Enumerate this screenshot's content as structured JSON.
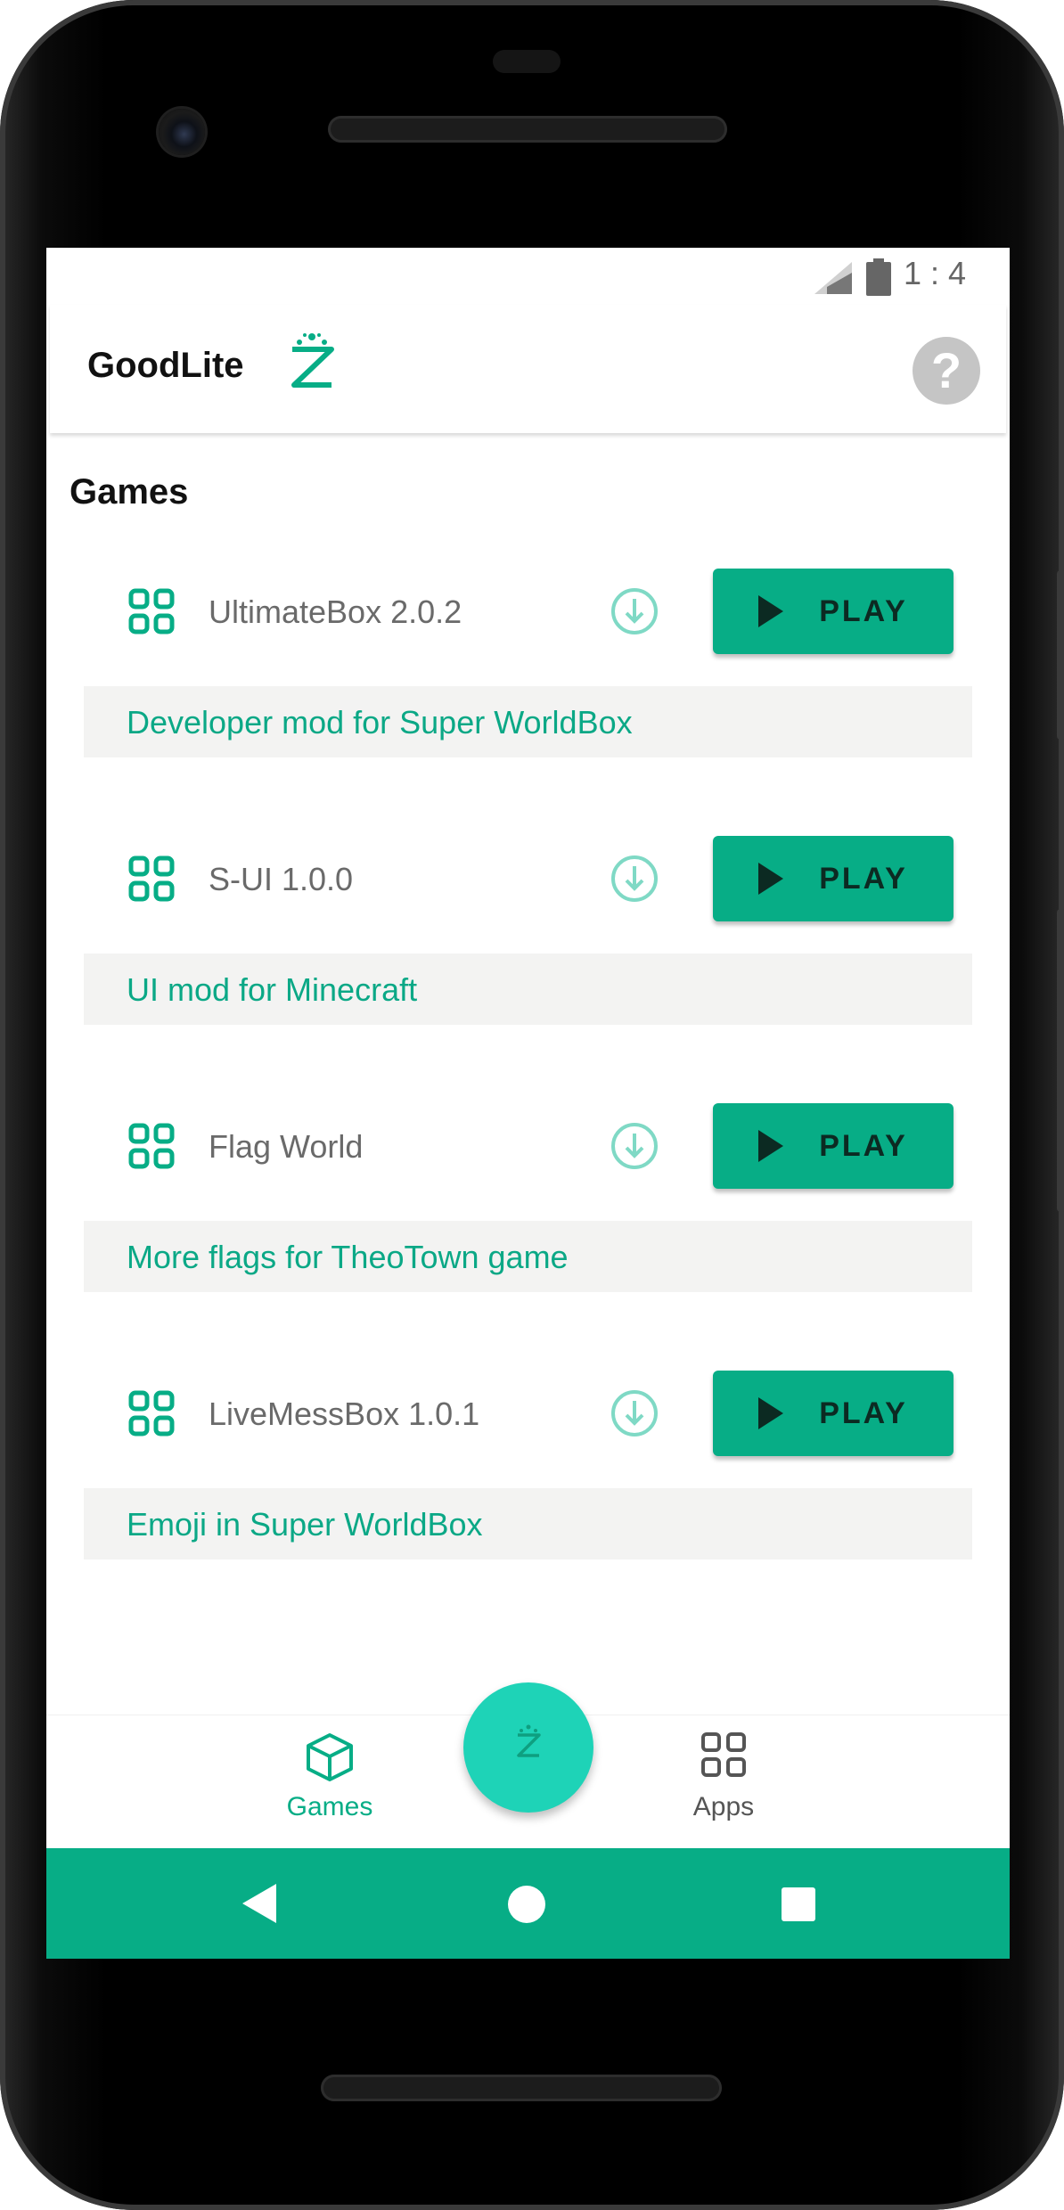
{
  "status_bar": {
    "time": "1:4"
  },
  "app_bar": {
    "logo_text": "GoodLite",
    "help_symbol": "?"
  },
  "section": {
    "title": "Games"
  },
  "items": [
    {
      "name": "UltimateBox 2.0.2",
      "play_label": "PLAY",
      "description": "Developer mod for Super WorldBox"
    },
    {
      "name": "S-UI 1.0.0",
      "play_label": "PLAY",
      "description": "UI mod for Minecraft"
    },
    {
      "name": "Flag World",
      "play_label": "PLAY",
      "description": "More flags for TheoTown game"
    },
    {
      "name": "LiveMessBox 1.0.1",
      "play_label": "PLAY",
      "description": "Emoji in Super WorldBox"
    }
  ],
  "bottom_nav": {
    "games_label": "Games",
    "apps_label": "Apps",
    "active": "games"
  },
  "colors": {
    "accent": "#07ad86",
    "accent_light": "#1ed3b7",
    "description_text": "#0ba886",
    "description_bg": "#f3f3f2",
    "inactive": "#555555"
  },
  "icons": {
    "app_item": "grid-icon",
    "download": "download-icon",
    "play": "play-icon",
    "help": "help-icon",
    "games_tab": "cube-icon",
    "apps_tab": "grid-icon",
    "fab": "hourglass-logo-icon"
  }
}
